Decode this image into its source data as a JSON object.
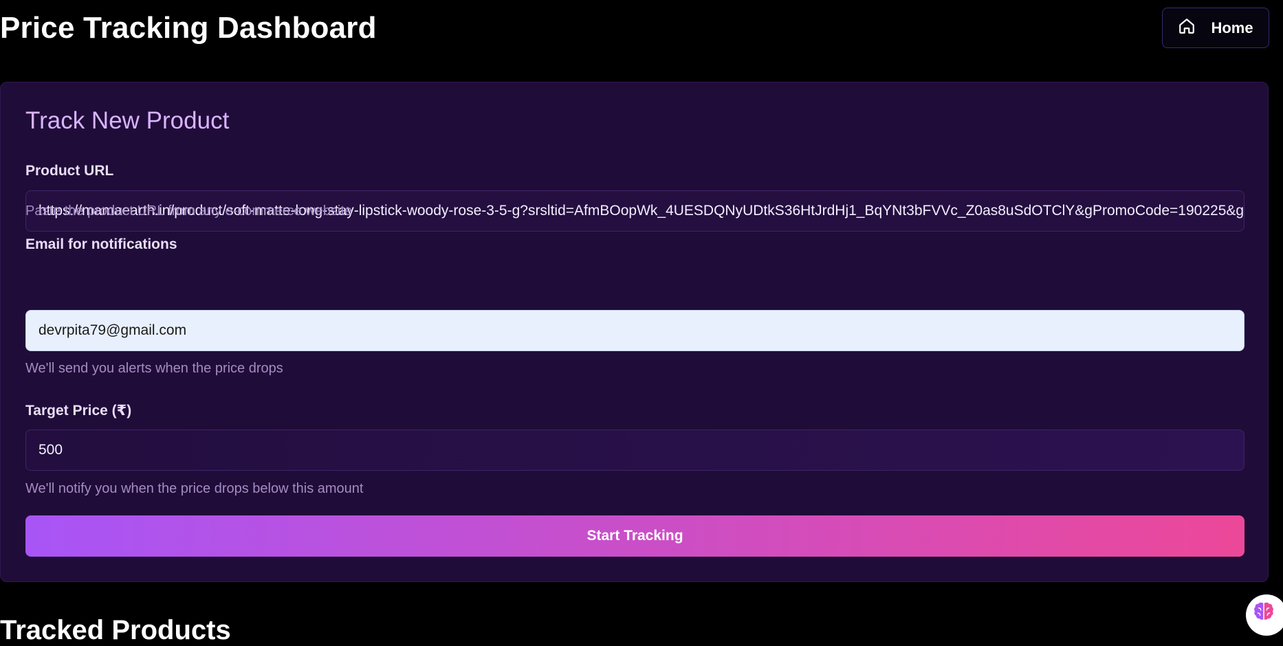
{
  "header": {
    "title": "Price Tracking Dashboard",
    "home_label": "Home",
    "home_icon": "home-icon"
  },
  "form": {
    "title": "Track New Product",
    "url": {
      "label": "Product URL",
      "value": "https://mamaearth.in/product/soft-matte-long-stay-lipstick-woody-rose-3-5-g?srsltid=AfmBOopWk_4UESDQNyUDtkS36HtJrdHj1_BqYNt3bFVVc_Z0as8uSdOTClY&gPromoCode=190225&g",
      "hint": "Paste the product URL from any e-commerce website"
    },
    "email": {
      "label": "Email for notifications",
      "value": "devrpita79@gmail.com",
      "hint": "We'll send you alerts when the price drops"
    },
    "price": {
      "label": "Target Price (₹)",
      "value": "500",
      "hint": "We'll notify you when the price drops below this amount"
    },
    "submit_label": "Start Tracking"
  },
  "tracked": {
    "title": "Tracked Products"
  },
  "widget": {
    "icon": "brain-icon"
  },
  "colors": {
    "background": "#000000",
    "card": "#200c38",
    "accent_title": "#d8b4fe",
    "gradient_start": "#a855f7",
    "gradient_end": "#ec4899"
  }
}
